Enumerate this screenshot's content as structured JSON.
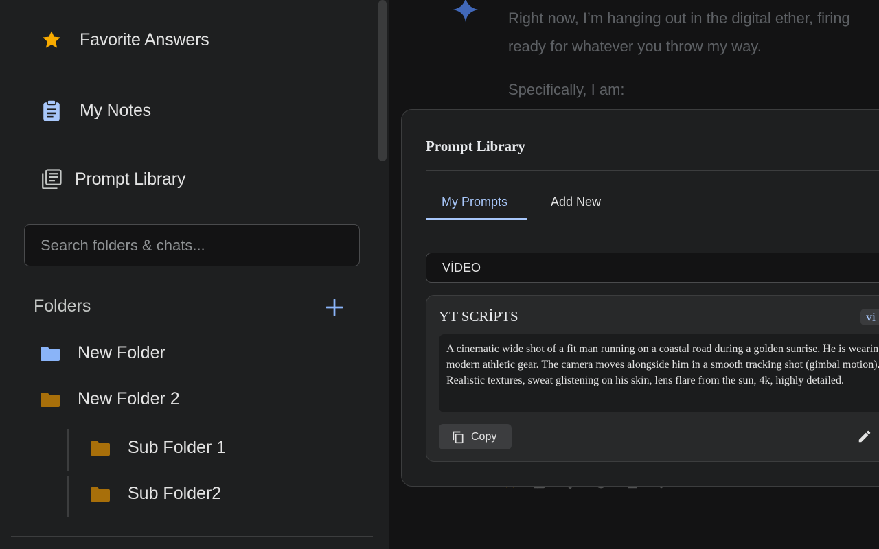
{
  "sidebar": {
    "nav": [
      {
        "label": "Favorite Answers",
        "icon": "star-icon"
      },
      {
        "label": "My Notes",
        "icon": "clipboard-icon"
      },
      {
        "label": "Prompt Library",
        "icon": "library-icon"
      }
    ],
    "search": {
      "placeholder": "Search folders & chats..."
    },
    "folders_title": "Folders",
    "folders": [
      {
        "name": "New Folder",
        "color": "#8ab4f8"
      },
      {
        "name": "New Folder 2",
        "color": "#a86f0a"
      },
      {
        "name": "Sub Folder 1",
        "color": "#a86f0a"
      },
      {
        "name": "Sub Folder2",
        "color": "#a86f0a"
      }
    ]
  },
  "chat": {
    "lines": [
      "Right now, I’m hanging out in the digital ether, firing",
      "ready for whatever you throw my way.",
      "Specifically, I am:"
    ]
  },
  "prompt_library": {
    "title": "Prompt Library",
    "tabs": [
      "My Prompts",
      "Add New"
    ],
    "category": "VİDEO",
    "prompts": [
      {
        "title": "YT SCRİPTS",
        "tag": "vi",
        "body": "A cinematic wide shot of a fit man running on a coastal road during a golden sunrise. He is wearing modern athletic gear. The camera moves alongside him in a smooth tracking shot (gimbal motion). Realistic textures, sweat glistening on his skin, lens flare from the sun, 4k, highly detailed.",
        "copy_label": "Copy"
      }
    ]
  },
  "colors": {
    "accent": "#a8c7fa",
    "star": "#f9ab00",
    "folder_blue": "#8ab4f8",
    "folder_gold": "#a86f0a"
  }
}
